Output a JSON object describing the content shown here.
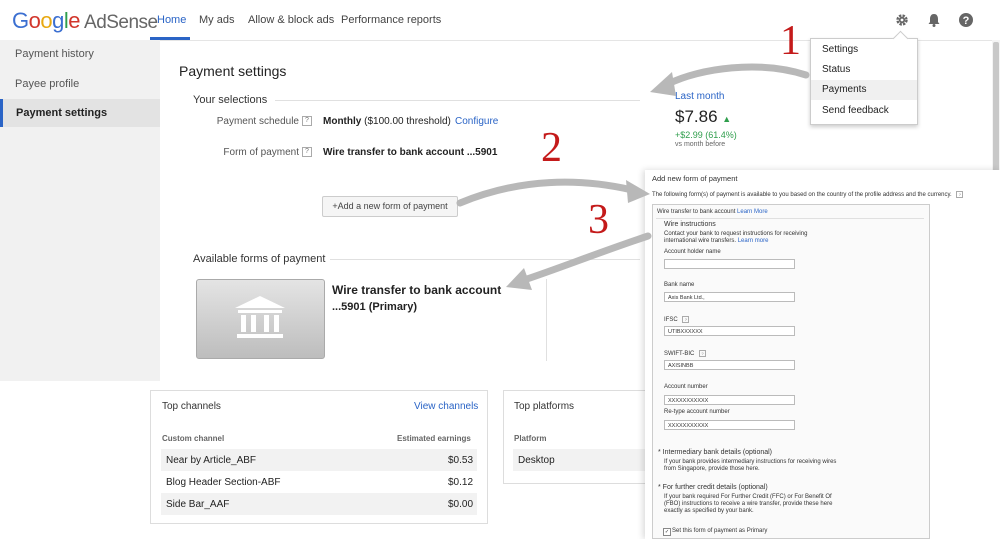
{
  "header": {
    "logo_google": [
      "G",
      "o",
      "o",
      "g",
      "l",
      "e"
    ],
    "logo_product": "AdSense",
    "nav": [
      "Home",
      "My ads",
      "Allow & block ads",
      "Performance reports"
    ]
  },
  "sidebar": {
    "items": [
      "Payment history",
      "Payee profile",
      "Payment settings"
    ]
  },
  "main": {
    "title": "Payment settings",
    "your_selections": "Your selections",
    "payment_schedule_label": "Payment schedule",
    "payment_schedule_value": "Monthly",
    "payment_schedule_threshold": "($100.00 threshold)",
    "configure": "Configure",
    "form_of_payment_label": "Form of payment",
    "form_of_payment_value": "Wire transfer to bank account ...5901",
    "add_new_button": "+Add a new form of payment",
    "available_forms": "Available forms of payment",
    "account_title_1": "Wire transfer to bank account",
    "account_title_2": "...5901 (Primary)"
  },
  "earnings": {
    "period": "Last month",
    "amount": "$7.86",
    "change": "+$2.99 (61.4%)",
    "compare": "vs month before"
  },
  "top_channels": {
    "title": "Top channels",
    "view_link": "View channels",
    "col1": "Custom channel",
    "col2": "Estimated earnings",
    "rows": [
      {
        "name": "Near by Article_ABF",
        "value": "$0.53"
      },
      {
        "name": "Blog Header Section-ABF",
        "value": "$0.12"
      },
      {
        "name": "Side Bar_AAF",
        "value": "$0.00"
      }
    ]
  },
  "top_platforms": {
    "title": "Top platforms",
    "col1": "Platform",
    "rows": [
      "Desktop"
    ]
  },
  "dropdown": {
    "items": [
      "Settings",
      "Status",
      "Payments",
      "Send feedback"
    ]
  },
  "annotations": [
    "1",
    "2",
    "3"
  ],
  "form_panel": {
    "title": "Add new form of payment",
    "intro": "The following form(s) of payment is available to you based on the country of the profile address and the currency.",
    "method": "Wire transfer to bank account",
    "learn_more": "Learn More",
    "wire_instructions": "Wire instructions",
    "wire_text_1": "Contact your bank to request instructions for receiving",
    "wire_text_2": "international wire transfers.",
    "learn_more_2": "Learn more",
    "fields": [
      {
        "label": "Account holder name",
        "value": ""
      },
      {
        "label": "Bank name",
        "value": "Axis Bank Ltd.,"
      },
      {
        "label": "IFSC",
        "value": "UTIBXXXXXX"
      },
      {
        "label": "SWIFT-BIC",
        "value": "AXISINBB"
      },
      {
        "label": "Account number",
        "value": "XXXXXXXXXXX"
      },
      {
        "label": "Re-type account number",
        "value": "XXXXXXXXXXX"
      }
    ],
    "intermediary_title": "Intermediary bank details (optional)",
    "intermediary_text_1": "If your bank provides intermediary instructions for receiving wires",
    "intermediary_text_2": "from Singapore, provide those here.",
    "further_title": "For further credit details (optional)",
    "further_text_1": "If your bank required For Further Credit (FFC) or For Benefit Of",
    "further_text_2": "(FBO) instructions to receive a wire transfer, provide these here",
    "further_text_3": "exactly as specified by your bank.",
    "primary_checkbox": "Set this form of payment as Primary"
  }
}
